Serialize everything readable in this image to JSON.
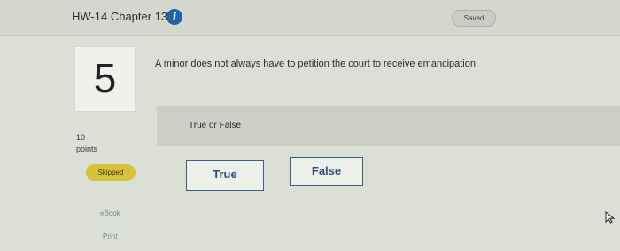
{
  "header": {
    "title": "HW-14 Chapter 13",
    "info_icon": "info-icon",
    "status": "Saved"
  },
  "question": {
    "number": "5",
    "text": "A minor does not always have to petition the court to receive emancipation.",
    "prompt": "True or False",
    "points_value": "10",
    "points_label": "points",
    "status_badge": "Skipped",
    "options": [
      "True",
      "False"
    ]
  },
  "links": {
    "ebook": "eBook",
    "print": "Print"
  },
  "colors": {
    "info_icon": "#1e66a8",
    "skipped_badge": "#d8c23a",
    "button_border": "#3d5f86"
  }
}
